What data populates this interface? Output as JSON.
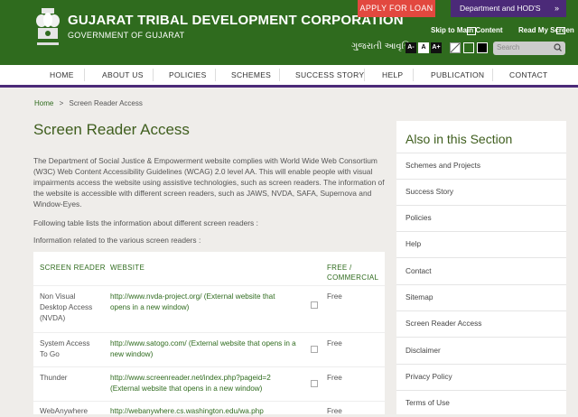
{
  "header": {
    "org_title": "GUJARAT TRIBAL DEVELOPMENT CORPORATION",
    "org_subtitle": "GOVERNMENT OF GUJARAT",
    "apply_loan": "APPLY FOR LOAN",
    "dept_menu": "Department and HOD'S",
    "skip_main": "Skip to Main Content",
    "screen_reader": "Read My Screen",
    "language": "ગુજરાતી આવૃત્તિ",
    "font_small": "A-",
    "font_normal": "A",
    "font_large": "A+",
    "search_placeholder": "Search",
    "colors": {
      "green": "#2f6b1e",
      "purple": "#4b2a78",
      "red": "#e2483f"
    }
  },
  "nav": [
    "HOME",
    "ABOUT US",
    "POLICIES",
    "SCHEMES",
    "SUCCESS STORY",
    "HELP",
    "PUBLICATION",
    "CONTACT"
  ],
  "breadcrumb": {
    "home": "Home",
    "sep": ">",
    "current": "Screen Reader Access"
  },
  "main": {
    "title": "Screen Reader Access",
    "intro": "The Department of Social Justice & Empowerment website complies with World Wide Web Consortium (W3C) Web Content Accessibility Guidelines (WCAG) 2.0 level AA. This will enable people with visual impairments access the website using assistive technologies, such as screen readers. The information of the website is accessible with different screen readers, such as JAWS, NVDA, SAFA, Supernova and Window-Eyes.",
    "following": "Following table lists the information about different screen readers :",
    "info": "Information related to the various screen readers :",
    "table": {
      "headers": [
        "SCREEN READER",
        "WEBSITE",
        "FREE / COMMERCIAL"
      ],
      "rows": [
        {
          "reader": "Non Visual Desktop Access (NVDA)",
          "website": "http://www.nvda-project.org/ (External website that opens in a new window)",
          "type": "Free"
        },
        {
          "reader": "System Access To Go",
          "website": "http://www.satogo.com/ (External website that opens in a new window)",
          "type": "Free"
        },
        {
          "reader": "Thunder",
          "website": "http://www.screenreader.net/index.php?pageid=2 (External website that opens in a new window)",
          "type": "Free"
        },
        {
          "reader": "WebAnywhere",
          "website": "http://webanywhere.cs.washington.edu/wa.php",
          "type": "Free"
        }
      ]
    }
  },
  "sidebar": {
    "title": "Also in this Section",
    "items": [
      "Schemes and Projects",
      "Success Story",
      "Policies",
      "Help",
      "Contact",
      "Sitemap",
      "Screen Reader Access",
      "Disclaimer",
      "Privacy Policy",
      "Terms of Use"
    ]
  }
}
